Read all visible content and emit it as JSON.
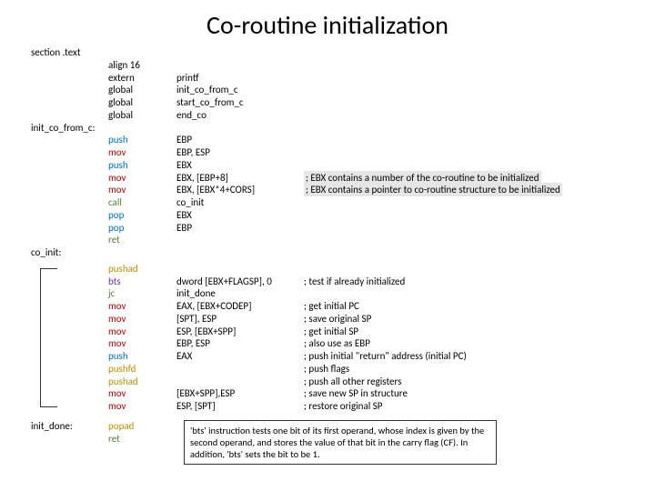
{
  "title": "Co-routine initialization",
  "section": "section .text",
  "labels": {
    "init_co_from_c": "init_co_from_c:",
    "co_init": "co_init:",
    "init_done": "init_done:"
  },
  "block1": [
    {
      "i": "align 16",
      "o": "",
      "c": ""
    },
    {
      "i": "extern",
      "o": "printf",
      "c": ""
    },
    {
      "i": "global",
      "o": "init_co_from_c",
      "c": ""
    },
    {
      "i": "global",
      "o": "start_co_from_c",
      "c": ""
    },
    {
      "i": "global",
      "o": "end_co",
      "c": ""
    }
  ],
  "block2": [
    {
      "i": "push",
      "o": "EBP",
      "c": ""
    },
    {
      "i": "mov",
      "o": "EBP, ESP",
      "c": ""
    },
    {
      "i": "push",
      "o": "EBX",
      "c": ""
    },
    {
      "i": "mov",
      "o": "EBX, [EBP+8]",
      "c": ";  EBX contains a number of the co-routine to be initialized",
      "hl": true
    },
    {
      "i": "mov",
      "o": "EBX, [EBX*4+CORS]",
      "c": ";  EBX contains a pointer to co-routine structure to be initialized",
      "hl": true
    },
    {
      "i": "call",
      "o": "co_init",
      "c": ""
    },
    {
      "i": "pop",
      "o": "EBX",
      "c": ""
    },
    {
      "i": "pop",
      "o": "EBP",
      "c": ""
    },
    {
      "i": "ret",
      "o": "",
      "c": ""
    }
  ],
  "block3": [
    {
      "i": "pushad",
      "o": "",
      "c": ""
    },
    {
      "i": "bts",
      "o": "dword [EBX+FLAGSP], 0",
      "c": "; test if already initialized"
    },
    {
      "i": "jc",
      "o": "init_done",
      "c": ""
    },
    {
      "i": "mov",
      "o": "EAX, [EBX+CODEP]",
      "c": "; get initial PC"
    },
    {
      "i": "mov",
      "o": "[SPT], ESP",
      "c": "; save original SP"
    },
    {
      "i": "mov",
      "o": "ESP, [EBX+SPP]",
      "c": "; get initial SP"
    },
    {
      "i": "mov",
      "o": "EBP, ESP",
      "c": "; also use as EBP"
    },
    {
      "i": "push",
      "o": "EAX",
      "c": "; push initial \"return\" address (initial PC)"
    },
    {
      "i": "pushfd",
      "o": "",
      "c": "; push flags"
    },
    {
      "i": "pushad",
      "o": "",
      "c": "; push all other registers"
    },
    {
      "i": "mov",
      "o": "[EBX+SPP],ESP",
      "c": "; save new SP in structure"
    },
    {
      "i": "mov",
      "o": "ESP, [SPT]",
      "c": "; restore original SP"
    }
  ],
  "block4": [
    {
      "i": "popad",
      "o": "",
      "c": ""
    },
    {
      "i": "ret",
      "o": "",
      "c": ""
    }
  ],
  "colors": {
    "push": "blue",
    "pop": "blue",
    "pushad": "gold",
    "popad": "gold",
    "pushfd": "gold",
    "mov": "red",
    "call": "green",
    "ret": "green",
    "jc": "green",
    "bts": "purple",
    "align 16": "",
    "extern": "",
    "global": ""
  },
  "note": "'bts' instruction tests one bit of its first operand, whose index is given by the second operand, and stores the value of that bit in the carry flag (CF). In addition, 'bts' sets the bit to be 1."
}
